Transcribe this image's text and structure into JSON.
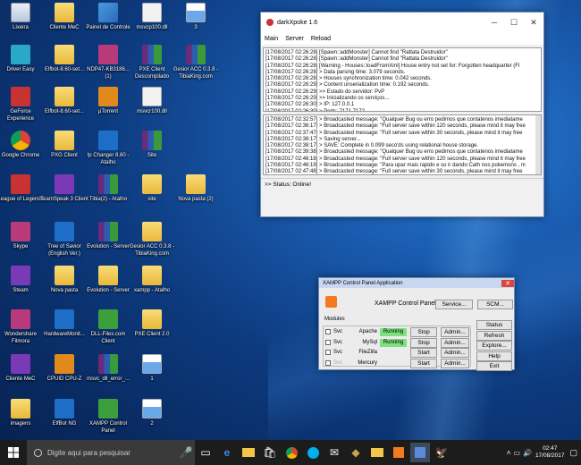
{
  "desktop": {
    "icons": [
      {
        "label": "Lixeira",
        "type": "recycle-bin"
      },
      {
        "label": "Cliente MeC",
        "type": "folder"
      },
      {
        "label": "Painel de Controle",
        "type": "control-panel"
      },
      {
        "label": "msvcp100.dll",
        "type": "file"
      },
      {
        "label": "3",
        "type": "image"
      },
      {
        "label": "Driver Easy",
        "type": "app"
      },
      {
        "label": "Elfbot-8.60-set...",
        "type": "folder"
      },
      {
        "label": "NDP47-KB3186... (1)",
        "type": "app"
      },
      {
        "label": "PXE Client Descompilado",
        "type": "rar"
      },
      {
        "label": "Gesior ACC 0.3.8 - TibiaKing.com",
        "type": "rar"
      },
      {
        "label": "GeForce Experience",
        "type": "app"
      },
      {
        "label": "Elfbot-8.60-set...",
        "type": "folder"
      },
      {
        "label": "µTorrent",
        "type": "app"
      },
      {
        "label": "msvcr100.dll",
        "type": "file"
      },
      {
        "label": "Google Chrome",
        "type": "chrome"
      },
      {
        "label": "PXG Client",
        "type": "folder"
      },
      {
        "label": "Ip Changer 8.60 - Atalho",
        "type": "app"
      },
      {
        "label": "Site",
        "type": "rar"
      },
      {
        "label": "League of Legends",
        "type": "app"
      },
      {
        "label": "TeamSpeak 3 Client",
        "type": "app"
      },
      {
        "label": "Tibia(2) - Atalho",
        "type": "rar"
      },
      {
        "label": "site",
        "type": "folder"
      },
      {
        "label": "Nova pasta (2)",
        "type": "folder"
      },
      {
        "label": "Skype",
        "type": "app"
      },
      {
        "label": "Tree of Savior (English Ver.)",
        "type": "app"
      },
      {
        "label": "Evolution - Server",
        "type": "rar"
      },
      {
        "label": "Gesior ACC 0.3.8 - TibiaKing.com",
        "type": "folder"
      },
      {
        "label": "Steam",
        "type": "app"
      },
      {
        "label": "Nova pasta",
        "type": "folder"
      },
      {
        "label": "Evolution - Server",
        "type": "folder"
      },
      {
        "label": "xampp - Atalho",
        "type": "folder"
      },
      {
        "label": "Wondershare Filmora",
        "type": "app"
      },
      {
        "label": "HardwareMonit...",
        "type": "app"
      },
      {
        "label": "DLL-Files.com Client",
        "type": "app"
      },
      {
        "label": "PXE Client 2.0",
        "type": "folder"
      },
      {
        "label": "Cliente MeC",
        "type": "app"
      },
      {
        "label": "CPUID CPU-Z",
        "type": "app"
      },
      {
        "label": "msvc_dll_error_...",
        "type": "rar"
      },
      {
        "label": "1",
        "type": "image"
      },
      {
        "label": "imagens",
        "type": "folder"
      },
      {
        "label": "ElfBot NG",
        "type": "app"
      },
      {
        "label": "XAMPP Control Panel",
        "type": "app"
      },
      {
        "label": "2",
        "type": "image"
      }
    ]
  },
  "server_window": {
    "title": "darkXpoke 1.6",
    "menu": [
      "Main",
      "Server",
      "Reload"
    ],
    "log1": [
      "[17/08/2017 02:26:28] [Spawn::addMonster] Cannot find \"Rattata Destruidor\"",
      "[17/08/2017 02:26:28] [Spawn::addMonster] Cannot find \"Rattata Destruidor\"",
      "[17/08/2017 02:26:28] [Warning - Houses::loadFromXml] House entry not set for: Forgotten headquarter (Fl",
      "[17/08/2017 02:26:28] > Data parsing time: 3.079 seconds.",
      "[17/08/2017 02:26:28] > Houses synchronization time: 0.042 seconds.",
      "[17/08/2017 02:26:29] > Content unserialization time: 0.192 seconds.",
      "[17/08/2017 02:26:29] >> Estado do servidor: PvP",
      "[17/08/2017 02:26:29] >> Inicializando os serviços...",
      "[17/08/2017 02:26:30] > IP: 127.0.0.1",
      "[17/08/2017 02:26:30] > Ports: 7171   7172",
      "[17/08/2017 02:26:30] >> Carregamento completo, servidor ONLINE!",
      "[17/08/2017 02:26:30] >> Mew server Online!"
    ],
    "log2": [
      "[17/08/2017 02:32:57] > Broadcasted message: \"Qualquer Bug ou erro pedimos que contatenos imediatame",
      "[17/08/2017 02:36:17] > Broadcasted message: \"Full server save within 120 seconds, please mind it may free",
      "[17/08/2017 02:37:47] > Broadcasted message: \"Full server save within 30 seconds, please mind it may free",
      "[17/08/2017 02:38:17] > Saving server...",
      "[17/08/2017 02:38:17] > SAVE: Complete in 0.099 seco'ds using relational house storage.",
      "[17/08/2017 02:39:38] > Broadcasted message: \"Qualquer Bug ou erro pedimos que contatenos imediatame",
      "[17/08/2017 02:46:18] > Broadcasted message: \"Full server save within 120 seconds, please mind it may free",
      "[17/08/2017 02:46:19] > Broadcasted message: \"Para upar mais rapido e so ir dando Cath nos pokemons , m",
      "[17/08/2017 02:47:48] > Broadcasted message: \"Full server save within 30 seconds, please mind it may free"
    ],
    "status": ">> Status: Online!"
  },
  "xampp": {
    "title": "XAMPP Control Panel Application",
    "header": "XAMPP Control Panel",
    "service_btn": "Service...",
    "scm_btn": "SCM...",
    "modules_label": "Modules",
    "rows": [
      {
        "svc": "Svc",
        "name": "Apache",
        "status": "Running",
        "action": "Stop",
        "admin": "Admin..."
      },
      {
        "svc": "Svc",
        "name": "MySql",
        "status": "Running",
        "action": "Stop",
        "admin": "Admin..."
      },
      {
        "svc": "Svc",
        "name": "FileZilla",
        "status": "",
        "action": "Start",
        "admin": "Admin..."
      },
      {
        "svc": "Svc",
        "name": "Mercury",
        "status": "",
        "action": "Start",
        "admin": "Admin..."
      }
    ],
    "side": [
      "Status",
      "Refresh",
      "Explore...",
      "Help",
      "Exit"
    ]
  },
  "taskbar": {
    "search_placeholder": "Digite aqui para pesquisar",
    "time": "02:47",
    "date": "17/08/2017"
  },
  "colors": {
    "running": "#7ee07e"
  }
}
